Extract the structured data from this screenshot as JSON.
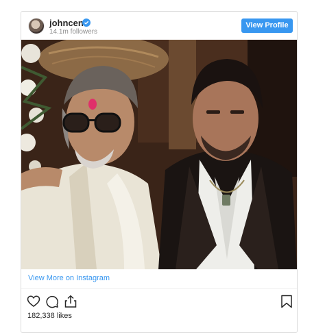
{
  "post": {
    "username": "johncena",
    "followers": "14.1m followers",
    "view_profile_label": "View Profile",
    "view_more_label": "View More on Instagram",
    "likes": "182,338 likes"
  },
  "icons": {
    "verified": "verified-badge-icon",
    "like": "heart-icon",
    "comment": "comment-icon",
    "share": "share-icon",
    "save": "bookmark-icon"
  },
  "colors": {
    "accent": "#3897f0",
    "text": "#262626",
    "muted": "#8e8e8e"
  }
}
